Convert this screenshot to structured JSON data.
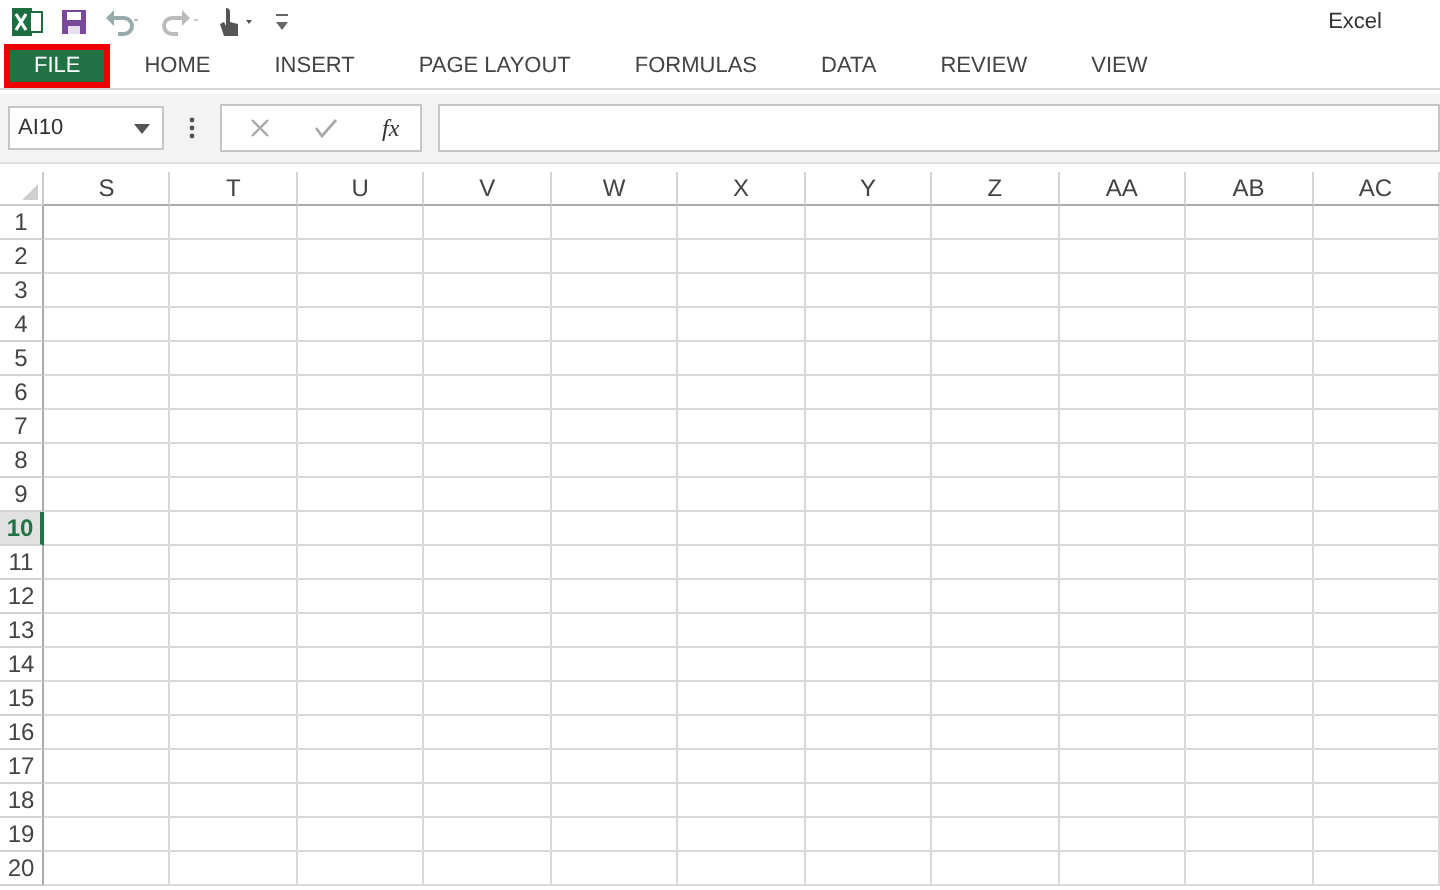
{
  "window": {
    "title": "Excel"
  },
  "tabs": [
    {
      "label": "FILE",
      "selected": true,
      "highlighted": true
    },
    {
      "label": "HOME",
      "selected": false,
      "highlighted": false
    },
    {
      "label": "INSERT",
      "selected": false,
      "highlighted": false
    },
    {
      "label": "PAGE LAYOUT",
      "selected": false,
      "highlighted": false
    },
    {
      "label": "FORMULAS",
      "selected": false,
      "highlighted": false
    },
    {
      "label": "DATA",
      "selected": false,
      "highlighted": false
    },
    {
      "label": "REVIEW",
      "selected": false,
      "highlighted": false
    },
    {
      "label": "VIEW",
      "selected": false,
      "highlighted": false
    }
  ],
  "name_box": {
    "value": "AI10"
  },
  "formula_bar": {
    "fx": "fx"
  },
  "columns": [
    "S",
    "T",
    "U",
    "V",
    "W",
    "X",
    "Y",
    "Z",
    "AA",
    "AB",
    "AC"
  ],
  "rows": [
    {
      "label": "1",
      "selected": false
    },
    {
      "label": "2",
      "selected": false
    },
    {
      "label": "3",
      "selected": false
    },
    {
      "label": "4",
      "selected": false
    },
    {
      "label": "5",
      "selected": false
    },
    {
      "label": "6",
      "selected": false
    },
    {
      "label": "7",
      "selected": false
    },
    {
      "label": "8",
      "selected": false
    },
    {
      "label": "9",
      "selected": false
    },
    {
      "label": "10",
      "selected": true
    },
    {
      "label": "11",
      "selected": false
    },
    {
      "label": "12",
      "selected": false
    },
    {
      "label": "13",
      "selected": false
    },
    {
      "label": "14",
      "selected": false
    },
    {
      "label": "15",
      "selected": false
    },
    {
      "label": "16",
      "selected": false
    },
    {
      "label": "17",
      "selected": false
    },
    {
      "label": "18",
      "selected": false
    },
    {
      "label": "19",
      "selected": false
    },
    {
      "label": "20",
      "selected": false
    }
  ]
}
